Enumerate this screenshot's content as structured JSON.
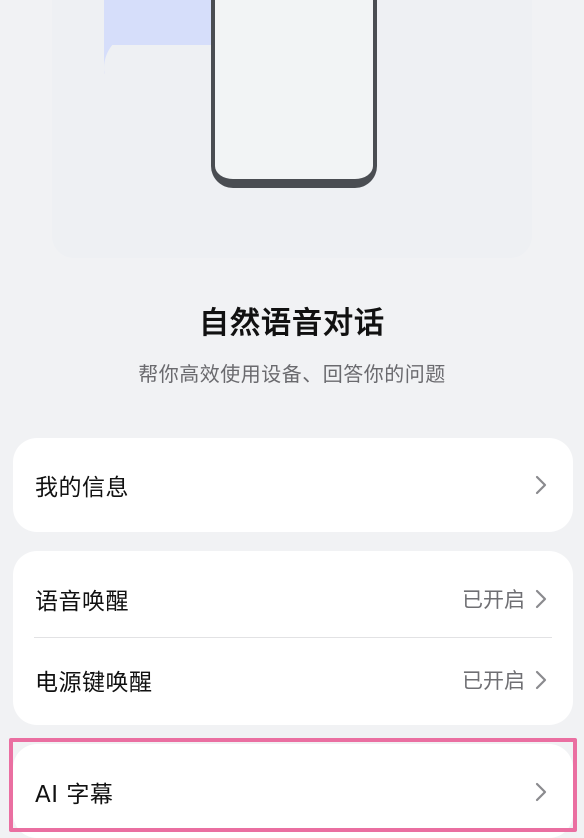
{
  "header": {
    "title": "自然语音对话",
    "subtitle": "帮你高效使用设备、回答你的问题"
  },
  "cards": [
    {
      "rows": [
        {
          "label": "我的信息",
          "status": ""
        }
      ]
    },
    {
      "rows": [
        {
          "label": "语音唤醒",
          "status": "已开启"
        },
        {
          "label": "电源键唤醒",
          "status": "已开启"
        }
      ]
    },
    {
      "rows": [
        {
          "label": "AI 字幕",
          "status": ""
        }
      ]
    }
  ],
  "icons": {
    "row_chevron": "chevron-right-icon"
  },
  "colors": {
    "background": "#f1f2f4",
    "card": "#ffffff",
    "highlight": "#ea6fa1",
    "bubble": "#d6defa"
  }
}
